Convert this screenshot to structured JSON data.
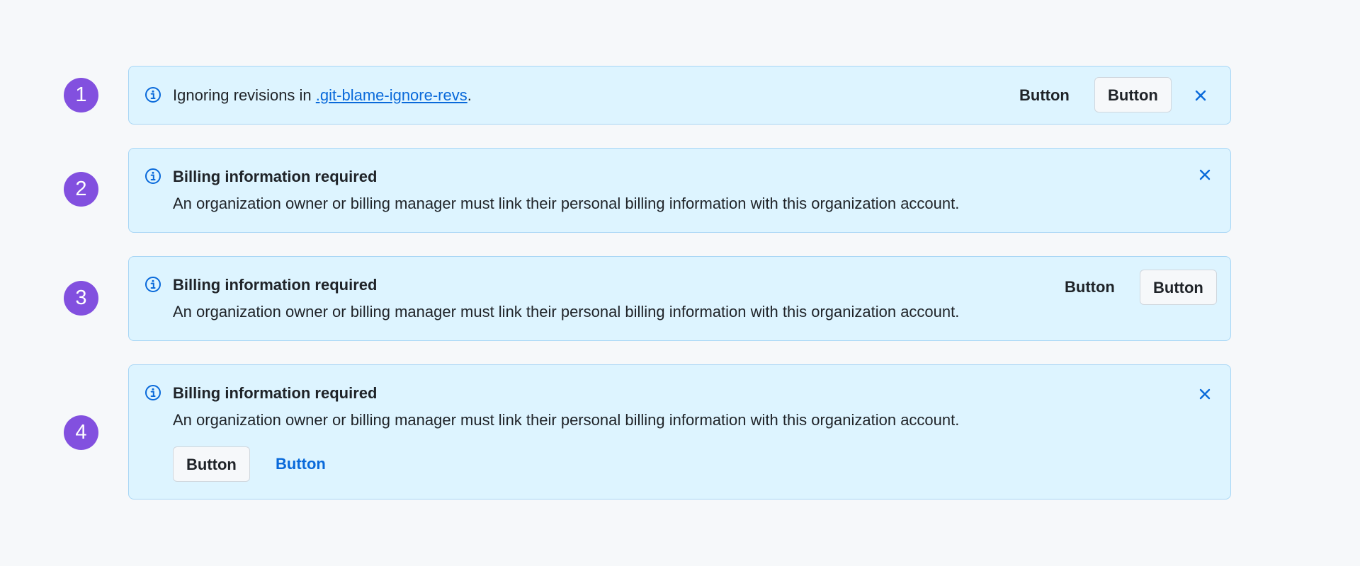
{
  "colors": {
    "background": "#f6f8fa",
    "badge": "#8250df",
    "banner_bg": "#ddf4ff",
    "banner_border": "#a8d6f5",
    "accent": "#0969da",
    "text": "#1f2328"
  },
  "icons": {
    "info": "info-circle-icon",
    "close": "x-close-icon"
  },
  "banners": [
    {
      "badge": "1",
      "message_before": "Ignoring revisions in ",
      "message_link": ".git-blame-ignore-revs",
      "message_after": ".",
      "secondary_button": "Button",
      "primary_button": "Button"
    },
    {
      "badge": "2",
      "title": "Billing information required",
      "description": "An organization owner or billing manager must link their personal billing information with this organization account."
    },
    {
      "badge": "3",
      "title": "Billing information required",
      "description": "An organization owner or billing manager must link their personal billing information with this organization account.",
      "secondary_button": "Button",
      "primary_button": "Button"
    },
    {
      "badge": "4",
      "title": "Billing information required",
      "description": "An organization owner or billing manager must link their personal billing information with this organization account.",
      "primary_button": "Button",
      "link_button": "Button"
    }
  ]
}
